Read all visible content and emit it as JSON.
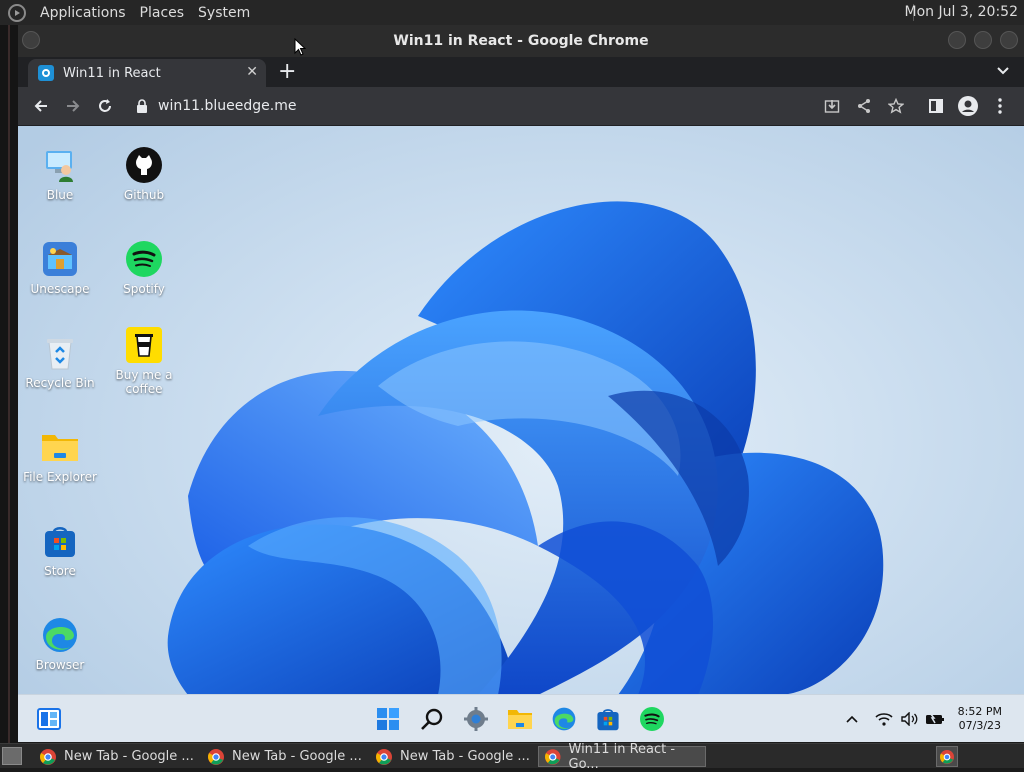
{
  "top_panel": {
    "menu": [
      "Applications",
      "Places",
      "System"
    ],
    "clock": "Mon Jul  3, 20:52"
  },
  "chrome": {
    "window_title": "Win11 in React - Google Chrome",
    "tab_title": "Win11 in React",
    "url": "win11.blueedge.me"
  },
  "desktop": {
    "icons": [
      {
        "label": "Blue",
        "icon": "user-computer-icon"
      },
      {
        "label": "Github",
        "icon": "github-icon"
      },
      {
        "label": "Unescape",
        "icon": "unescape-game-icon"
      },
      {
        "label": "Spotify",
        "icon": "spotify-icon"
      },
      {
        "label": "Recycle Bin",
        "icon": "recycle-bin-icon"
      },
      {
        "label": "Buy me a coffee",
        "icon": "coffee-cup-icon"
      },
      {
        "label": "File Explorer",
        "icon": "folder-icon"
      },
      {
        "label": "Store",
        "icon": "store-icon"
      },
      {
        "label": "Browser",
        "icon": "edge-browser-icon"
      }
    ]
  },
  "win_taskbar": {
    "time": "8:52 PM",
    "date": "07/3/23"
  },
  "host_taskbar": {
    "tasks": [
      "New Tab - Google ...",
      "New Tab - Google ...",
      "New Tab - Google ...",
      "Win11 in React - Go..."
    ]
  },
  "colors": {
    "accent_blue": "#1565e0",
    "spotify_green": "#1ed760"
  }
}
